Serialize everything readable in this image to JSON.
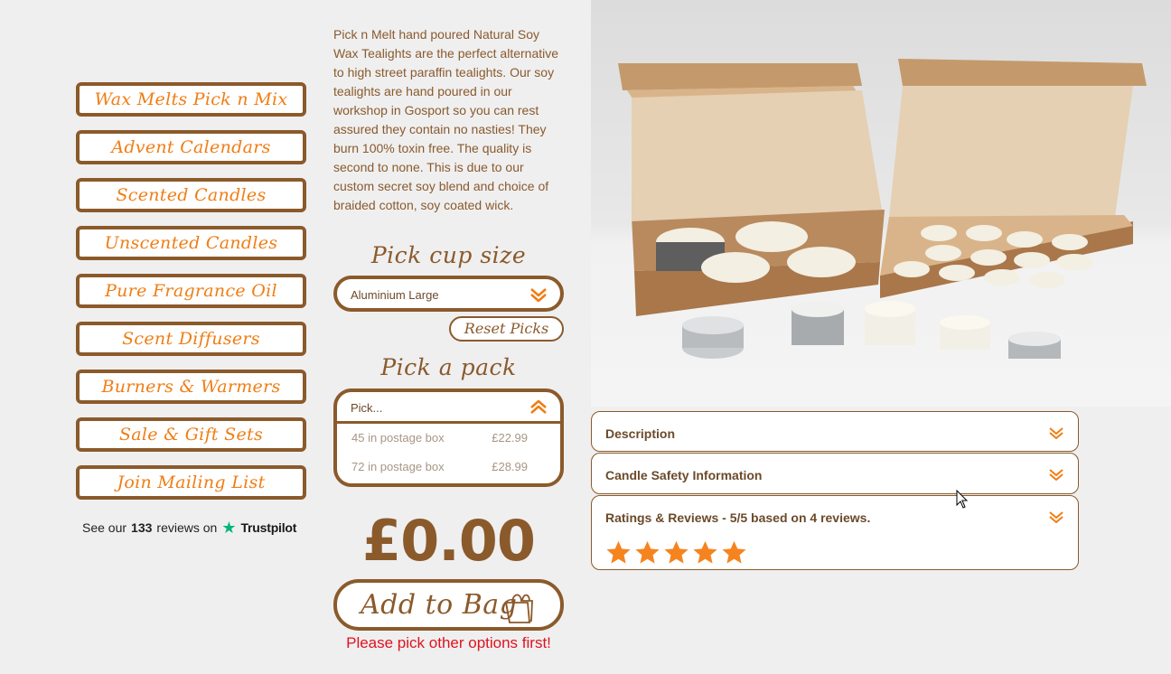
{
  "sidebar": {
    "items": [
      {
        "label": "Wax Melts Pick n Mix"
      },
      {
        "label": "Advent Calendars"
      },
      {
        "label": "Scented Candles"
      },
      {
        "label": "Unscented Candles"
      },
      {
        "label": "Pure Fragrance Oil"
      },
      {
        "label": "Scent Diffusers"
      },
      {
        "label": "Burners & Warmers"
      },
      {
        "label": "Sale & Gift Sets"
      },
      {
        "label": "Join Mailing List"
      }
    ],
    "trustpilot": {
      "prefix": "See our",
      "count": "133",
      "suffix": "reviews on",
      "brand": "Trustpilot"
    }
  },
  "product": {
    "description": "Pick n Melt hand poured Natural Soy Wax Tealights are the perfect alternative to high street paraffin tealights. Our soy tealights are hand poured in our workshop in Gosport so you can rest assured they contain no nasties! They burn 100% toxin free. The quality is second to none. This is due to our custom secret soy blend and choice of braided cotton, soy coated wick.",
    "cup_heading": "Pick cup size",
    "cup_selected": "Aluminium Large",
    "reset_label": "Reset Picks",
    "pack_heading": "Pick a pack",
    "pack_placeholder": "Pick...",
    "pack_options": [
      {
        "label": "45 in postage box",
        "price": "£22.99"
      },
      {
        "label": "72 in postage box",
        "price": "£28.99"
      }
    ],
    "price": "£0.00",
    "add_to_bag": "Add to Bag",
    "warning": "Please pick other options first!"
  },
  "accordion": [
    {
      "title": "Description"
    },
    {
      "title": "Candle Safety Information"
    },
    {
      "title": "Ratings & Reviews - 5/5 based on 4 reviews.",
      "rating": 5,
      "max_rating": 5
    }
  ],
  "colors": {
    "brand_brown": "#8b5a2b",
    "accent_orange": "#f07d14",
    "warning_red": "#e0121e",
    "star_orange": "#f5841f",
    "trustpilot_green": "#00b67a"
  },
  "icons": [
    "chevron-down-icon",
    "chevron-up-icon",
    "shopping-bag-icon",
    "star-icon",
    "trustpilot-star-icon",
    "mouse-cursor-icon"
  ]
}
